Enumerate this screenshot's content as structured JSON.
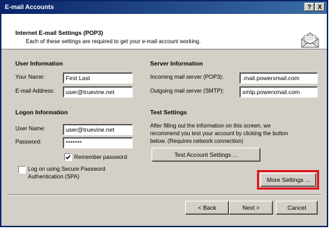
{
  "window": {
    "title": "E-mail Accounts",
    "help_glyph": "?",
    "close_glyph": "X"
  },
  "header": {
    "title": "Internet E-mail Settings (POP3)",
    "subtitle": "Each of these settings are required to get your e-mail account working."
  },
  "user_info": {
    "heading": "User Information",
    "name_label": "Your Name:",
    "name_value": "First Last",
    "email_label": "E-mail Address:",
    "email_value": "user@truevine.net"
  },
  "server_info": {
    "heading": "Server Information",
    "pop3_label": "Incoming mail server (POP3):",
    "pop3_value": ".mail.powerxmail.com",
    "smtp_label": "Outgoing mail server (SMTP):",
    "smtp_value": "smtp.powerxmail.com"
  },
  "logon_info": {
    "heading": "Logon Information",
    "username_label": "User Name:",
    "username_value": "user@truevine.net",
    "password_label": "Password:",
    "password_value": "*******",
    "remember_label": "Remember password",
    "remember_checked": true,
    "spa_label_line1": "Log on using Secure Password",
    "spa_label_line2": "Authentication (SPA)",
    "spa_checked": false
  },
  "test_settings": {
    "heading": "Test Settings",
    "line1": "After filling out the information on this screen, we",
    "line2": "recommend you test your account by clicking the button",
    "line3": "below. (Requires network connection)",
    "button_label": "Test Account Settings ..."
  },
  "more_settings_label": "More Settings ...",
  "footer": {
    "back_label": "< Back",
    "next_label": "Next >",
    "cancel_label": "Cancel"
  },
  "colors": {
    "highlight": "#e0141e",
    "titlebar": "#0a246a",
    "face": "#d4d0c8"
  },
  "icons": {
    "header": "envelope-icon",
    "check": "checkmark-icon"
  }
}
